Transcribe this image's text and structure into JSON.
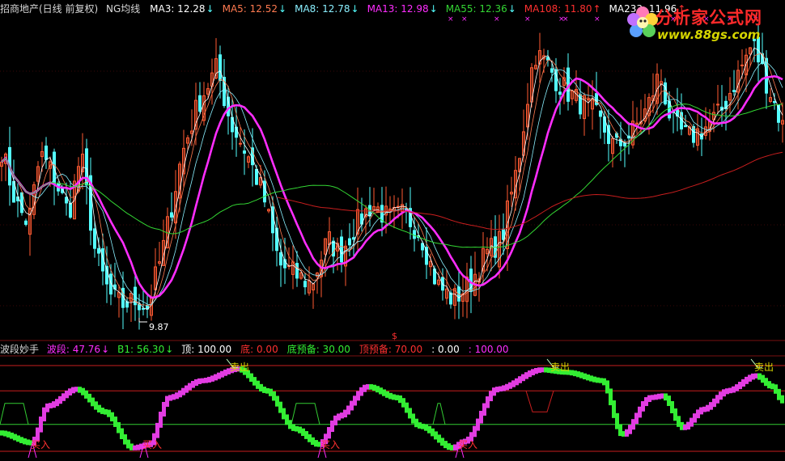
{
  "colors": {
    "background": "#000000",
    "candle_up": "#ff5a32",
    "candle_down": "#54ffff",
    "ma3": "#ffffff",
    "ma5": "#ff7a50",
    "ma8": "#8af0ff",
    "ma13": "#ff2dff",
    "ma55": "#33d633",
    "ma108": "#c81e1e",
    "ma233": "#ffffff",
    "wave_up": "#e23ce2",
    "wave_down": "#33ee33"
  },
  "header": {
    "title": "招商地产(日线 前复权)",
    "indicator": "NG均线",
    "ma_items": [
      {
        "label": "MA3: 12.28",
        "arrow": "↓",
        "color": "#ffffff",
        "arrow_color": "#54ffff"
      },
      {
        "label": "MA5: 12.52",
        "arrow": "↓",
        "color": "#ff7a50",
        "arrow_color": "#54ffff"
      },
      {
        "label": "MA8: 12.78",
        "arrow": "↓",
        "color": "#8af0ff",
        "arrow_color": "#54ffff"
      },
      {
        "label": "MA13: 12.98",
        "arrow": "↓",
        "color": "#ff2dff",
        "arrow_color": "#54ffff"
      },
      {
        "label": "MA55: 12.36",
        "arrow": "↓",
        "color": "#33d633",
        "arrow_color": "#54ffff"
      },
      {
        "label": "MA108: 11.80",
        "arrow": "↑",
        "color": "#ff3030",
        "arrow_color": "#ff3030"
      },
      {
        "label": "MA233: 11.96",
        "arrow": "↑",
        "color": "#ffffff",
        "arrow_color": "#ff3030"
      }
    ]
  },
  "logo": {
    "text_cn": "分析家公式网",
    "url": "www.88gs.com"
  },
  "price_panel": {
    "low_marker": "9.87",
    "top_marker": "$"
  },
  "indicator_panel": {
    "name": "波段妙手",
    "items": [
      {
        "label": "波段: 47.76",
        "arrow": "↓",
        "color": "#ff2dff"
      },
      {
        "label": "B1: 56.30",
        "arrow": "↓",
        "color": "#33ee33"
      },
      {
        "label": "顶: 100.00",
        "arrow": "",
        "color": "#ffffff"
      },
      {
        "label": "底: 0.00",
        "arrow": "",
        "color": "#ff3030"
      },
      {
        "label": "底预备: 30.00",
        "arrow": "",
        "color": "#33ee33"
      },
      {
        "label": "顶预备: 70.00",
        "arrow": "",
        "color": "#ff3030"
      },
      {
        "label": ": 0.00",
        "arrow": "",
        "color": "#ffffff"
      },
      {
        "label": ": 100.00",
        "arrow": "",
        "color": "#ff2dff"
      }
    ],
    "buy_label": "买入",
    "sell_label": "卖出"
  },
  "chart_data": [
    {
      "type": "candlestick",
      "title": "招商地产(日线 前复权)",
      "ylim": [
        9.5,
        15.5
      ],
      "marked_low": 9.87,
      "series": [
        {
          "name": "MA3",
          "value_last": 12.28
        },
        {
          "name": "MA5",
          "value_last": 12.52
        },
        {
          "name": "MA8",
          "value_last": 12.78
        },
        {
          "name": "MA13",
          "value_last": 12.98
        },
        {
          "name": "MA55",
          "value_last": 12.36
        },
        {
          "name": "MA108",
          "value_last": 11.8
        },
        {
          "name": "MA233",
          "value_last": 11.96
        }
      ]
    },
    {
      "type": "line",
      "title": "波段妙手",
      "ylim": [
        0,
        100
      ],
      "levels": {
        "top": 100,
        "bottom": 0,
        "bottom_ready": 30,
        "top_ready": 70
      },
      "series": [
        {
          "name": "波段",
          "value_last": 47.76
        },
        {
          "name": "B1",
          "value_last": 56.3
        }
      ],
      "buy_signals": 4,
      "sell_signals": 3
    }
  ]
}
